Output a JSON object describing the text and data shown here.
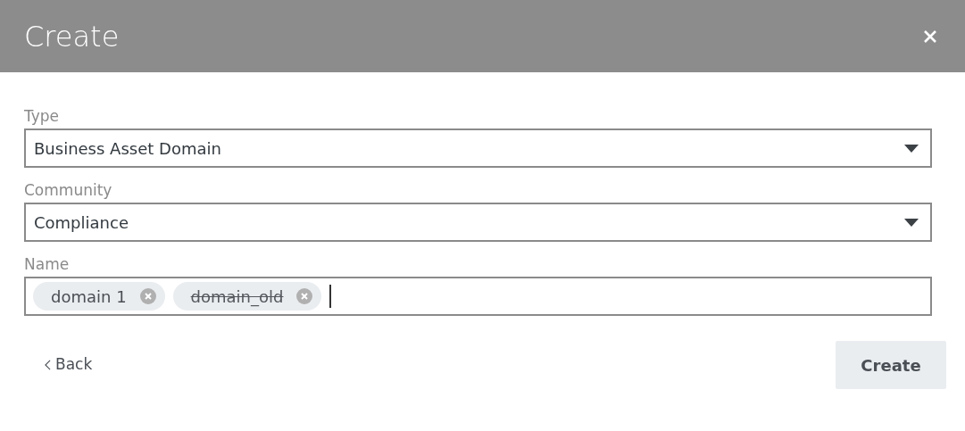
{
  "dialog": {
    "title": "Create"
  },
  "fields": [
    {
      "kind": "select",
      "label": "Type",
      "value": "Business Asset Domain"
    },
    {
      "kind": "select",
      "label": "Community",
      "value": "Compliance"
    },
    {
      "kind": "tags",
      "label": "Name",
      "tags": [
        {
          "text": "domain 1",
          "struck": false
        },
        {
          "text": "domain_old",
          "struck": true
        }
      ]
    }
  ],
  "back_link": "Back",
  "create_button": "Create"
}
